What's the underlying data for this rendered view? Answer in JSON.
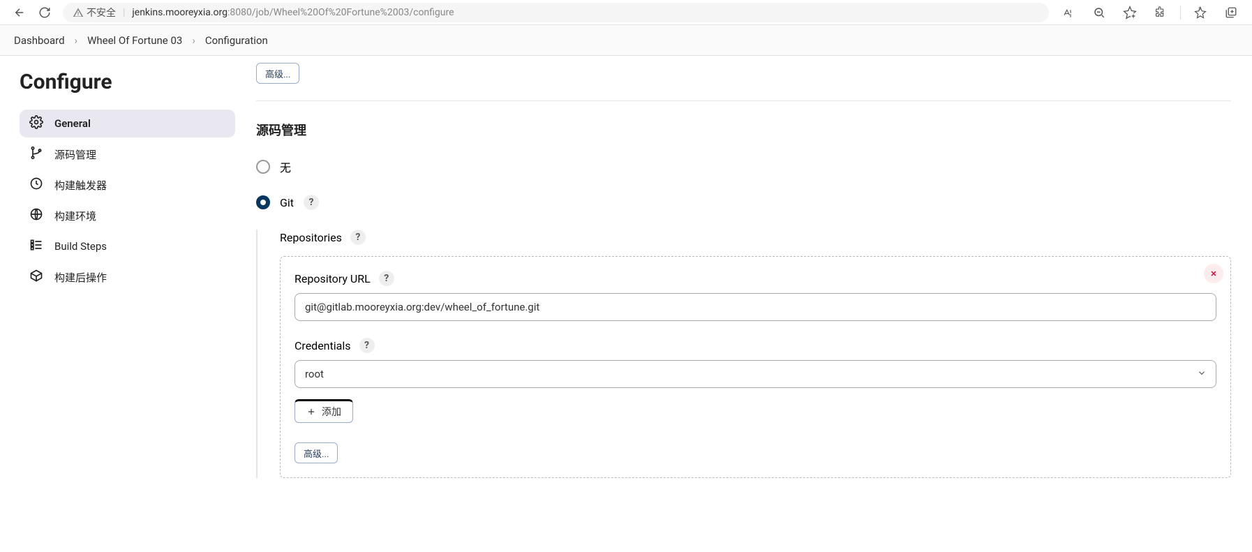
{
  "browser": {
    "insecure_label": "不安全",
    "url_host": "jenkins.mooreyxia.org",
    "url_port": ":8080",
    "url_path": "/job/Wheel%20Of%20Fortune%2003/configure"
  },
  "breadcrumbs": {
    "items": [
      "Dashboard",
      "Wheel Of Fortune 03",
      "Configuration"
    ]
  },
  "sidebar": {
    "title": "Configure",
    "items": [
      {
        "label": "General"
      },
      {
        "label": "源码管理"
      },
      {
        "label": "构建触发器"
      },
      {
        "label": "构建环境"
      },
      {
        "label": "Build Steps"
      },
      {
        "label": "构建后操作"
      }
    ]
  },
  "buttons": {
    "advanced_top": "高级...",
    "advanced_inner": "高级...",
    "add": "添加"
  },
  "section": {
    "scm_title": "源码管理",
    "radio_none": "无",
    "radio_git": "Git",
    "repositories_label": "Repositories",
    "repo_url_label": "Repository URL",
    "repo_url_value": "git@gitlab.mooreyxia.org:dev/wheel_of_fortune.git",
    "credentials_label": "Credentials",
    "credentials_value": "root"
  }
}
